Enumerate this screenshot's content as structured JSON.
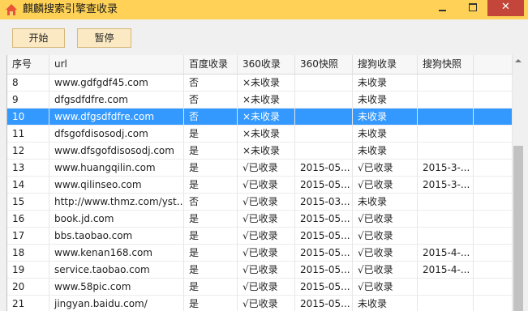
{
  "window": {
    "title": "麒麟搜索引擎查收录",
    "close_glyph": "✕"
  },
  "toolbar": {
    "start_label": "开始",
    "pause_label": "暂停"
  },
  "table": {
    "columns": [
      "序号",
      "url",
      "百度收录",
      "360收录",
      "360快照",
      "搜狗收录",
      "搜狗快照",
      ""
    ],
    "selected_row_index": 2,
    "rows": [
      [
        "8",
        "www.gdfgdf45.com",
        "否",
        "×未收录",
        "",
        "未收录",
        "",
        ""
      ],
      [
        "9",
        "dfgsdfdfre.com",
        "否",
        "×未收录",
        "",
        "未收录",
        "",
        ""
      ],
      [
        "10",
        "www.dfgsdfdfre.com",
        "否",
        "×未收录",
        "",
        "未收录",
        "",
        ""
      ],
      [
        "11",
        "dfsgofdisosodj.com",
        "是",
        "×未收录",
        "",
        "未收录",
        "",
        ""
      ],
      [
        "12",
        "www.dfsgofdisosodj.com",
        "是",
        "×未收录",
        "",
        "未收录",
        "",
        ""
      ],
      [
        "13",
        "www.huangqilin.com",
        "是",
        "√已收录",
        "2015-05...",
        "√已收录",
        "2015-3-...",
        ""
      ],
      [
        "14",
        "www.qilinseo.com",
        "是",
        "√已收录",
        "2015-05...",
        "√已收录",
        "2015-3-...",
        ""
      ],
      [
        "15",
        "http://www.thmz.com/yst...",
        "否",
        "√已收录",
        "2015-03...",
        "未收录",
        "",
        ""
      ],
      [
        "16",
        "book.jd.com",
        "是",
        "√已收录",
        "2015-05...",
        "√已收录",
        "",
        ""
      ],
      [
        "17",
        "bbs.taobao.com",
        "是",
        "√已收录",
        "2015-05...",
        "√已收录",
        "",
        ""
      ],
      [
        "18",
        "www.kenan168.com",
        "是",
        "√已收录",
        "2015-05...",
        "√已收录",
        "2015-4-...",
        ""
      ],
      [
        "19",
        "service.taobao.com",
        "是",
        "√已收录",
        "2015-05...",
        "√已收录",
        "2015-4-...",
        ""
      ],
      [
        "20",
        "www.58pic.com",
        "是",
        "√已收录",
        "2015-05...",
        "√已收录",
        "",
        ""
      ],
      [
        "21",
        "jingyan.baidu.com/",
        "是",
        "√已收录",
        "2015-05...",
        "未收录",
        "",
        ""
      ]
    ]
  },
  "colors": {
    "titlebar": "#ffd257",
    "selection": "#3399ff",
    "close_button": "#c4463a",
    "toolbar_button": "#fbe9c4"
  },
  "icons": {
    "app": "house-icon",
    "minimize": "minimize-icon",
    "maximize": "maximize-icon",
    "close": "close-icon",
    "scroll_up": "scroll-up-arrow-icon"
  }
}
